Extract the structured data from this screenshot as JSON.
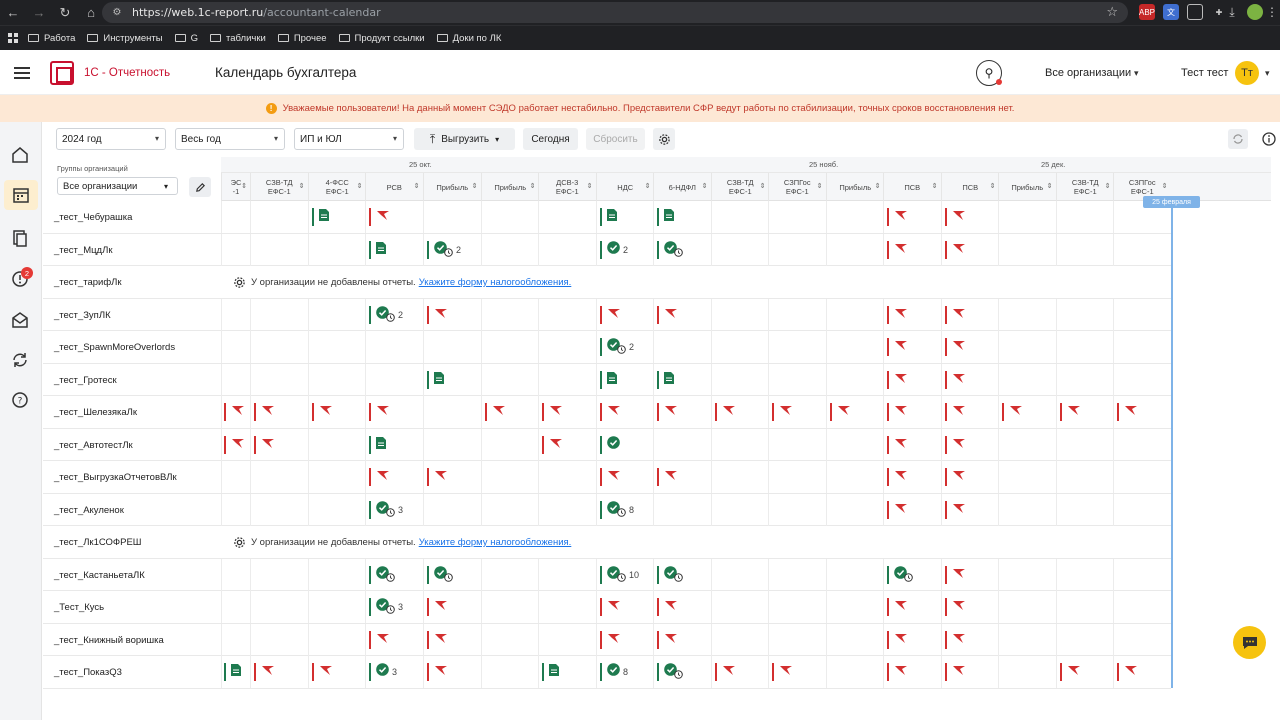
{
  "browser": {
    "url_domain": "https://web.1c-report.ru",
    "url_path": "/accountant-calendar",
    "bookmarks": [
      "Работа",
      "Инструменты",
      "G",
      "таблички",
      "Прочее",
      "Продукт ссылки",
      "Доки по ЛК"
    ]
  },
  "header": {
    "brand": "1С - Отчетность",
    "title": "Календарь бухгалтера",
    "org_select": "Все организации",
    "user_name": "Тест тест",
    "avatar_initials": "Тт",
    "brand_color": "#c8102e",
    "accent_color": "#f6c30f"
  },
  "banner": {
    "text": "Уважаемые пользователи! На данный момент СЭДО работает нестабильно. Представители СФР ведут работы по стабилизации, точных сроков восстановления нет."
  },
  "rail": {
    "items": [
      "home-icon",
      "calendar-icon",
      "documents-icon",
      "alert-icon",
      "mail-icon",
      "sync-icon",
      "help-icon"
    ],
    "alert_badge": "2"
  },
  "toolbar": {
    "year": "2024 год",
    "period": "Весь год",
    "org_type": "ИП и ЮЛ",
    "export_label": "Выгрузить",
    "today_label": "Сегодня",
    "reset_label": "Сбросить"
  },
  "table": {
    "group_label": "Группы организаций",
    "group_select": "Все организации",
    "months": [
      "25 окт.",
      "25 нояб.",
      "25 дек."
    ],
    "columns": [
      {
        "l1": "ЭС",
        "l2": "-1"
      },
      {
        "l1": "СЗВ-ТД",
        "l2": "ЕФС-1"
      },
      {
        "l1": "4-ФСС",
        "l2": "ЕФС-1"
      },
      {
        "l1": "РСВ",
        "l2": ""
      },
      {
        "l1": "Прибыль",
        "l2": ""
      },
      {
        "l1": "Прибыль",
        "l2": ""
      },
      {
        "l1": "ДСВ-3",
        "l2": "ЕФС-1"
      },
      {
        "l1": "НДС",
        "l2": ""
      },
      {
        "l1": "6-НДФЛ",
        "l2": ""
      },
      {
        "l1": "СЗВ-ТД",
        "l2": "ЕФС-1"
      },
      {
        "l1": "СЗПГос",
        "l2": "ЕФС-1"
      },
      {
        "l1": "Прибыль",
        "l2": ""
      },
      {
        "l1": "ПСВ",
        "l2": ""
      },
      {
        "l1": "ПСВ",
        "l2": ""
      },
      {
        "l1": "Прибыль",
        "l2": ""
      },
      {
        "l1": "СЗВ-ТД",
        "l2": "ЕФС-1"
      },
      {
        "l1": "СЗПГос",
        "l2": "ЕФС-1"
      }
    ],
    "today_tag": "25 февраля",
    "no_reports_text": "У организации не добавлены отчеты.",
    "no_reports_link": "Укажите форму налогообложения.",
    "rows": [
      {
        "name": "_тест_Чебурашка",
        "cells": {
          "2": "doc",
          "3": "flag",
          "7": "doc",
          "8": "doc",
          "12": "flag",
          "13": "flag"
        }
      },
      {
        "name": "_тест_МцдЛк",
        "cells": {
          "3": "doc",
          "4": "ok2",
          "7": "ok|2",
          "8": "okc",
          "12": "flag",
          "13": "flag"
        }
      },
      {
        "name": "_тест_тарифЛк",
        "empty": true
      },
      {
        "name": "_тест_ЗупЛК",
        "cells": {
          "3": "okc|2",
          "4": "flag",
          "7": "flag",
          "8": "flag",
          "12": "flag",
          "13": "flag"
        }
      },
      {
        "name": "_тест_SpawnMoreOverlords",
        "cells": {
          "7": "okc|2",
          "12": "flag",
          "13": "flag"
        }
      },
      {
        "name": "_тест_Гротеск",
        "cells": {
          "4": "doc",
          "7": "doc",
          "8": "doc",
          "12": "flag",
          "13": "flag"
        }
      },
      {
        "name": "_тест_ШелезякаЛк",
        "cells": {
          "0": "flag",
          "1": "flag",
          "2": "flag",
          "3": "flag",
          "5": "flag",
          "6": "flag",
          "7": "flag",
          "8": "flag",
          "9": "flag",
          "10": "flag",
          "11": "flag",
          "12": "flag",
          "13": "flag",
          "14": "flag",
          "15": "flag",
          "16": "flag"
        }
      },
      {
        "name": "_тест_АвтотестЛк",
        "cells": {
          "0": "flag",
          "1": "flag",
          "3": "doc",
          "6": "flag",
          "7": "ok",
          "12": "flag",
          "13": "flag"
        }
      },
      {
        "name": "_тест_ВыгрузкаОтчетовВЛк",
        "cells": {
          "3": "flag",
          "4": "flag",
          "7": "flag",
          "8": "flag",
          "12": "flag",
          "13": "flag"
        }
      },
      {
        "name": "_тест_Акуленок",
        "cells": {
          "3": "okc|3",
          "7": "okc|8",
          "12": "flag",
          "13": "flag"
        }
      },
      {
        "name": "_тест_Лк1СОФРЕШ",
        "empty": true
      },
      {
        "name": "_тест_КастаньетаЛК",
        "cells": {
          "3": "okc",
          "4": "okc",
          "7": "okc|10",
          "8": "okc",
          "12": "okc",
          "13": "flag"
        }
      },
      {
        "name": "_Тест_Кусь",
        "cells": {
          "3": "okc|3",
          "4": "flag",
          "7": "flag",
          "8": "flag",
          "12": "flag",
          "13": "flag"
        }
      },
      {
        "name": "_тест_Книжный воришка",
        "cells": {
          "3": "flag",
          "4": "flag",
          "7": "flag",
          "8": "flag",
          "12": "flag",
          "13": "flag"
        }
      },
      {
        "name": "_тест_ПоказQ3",
        "cells": {
          "0": "doc",
          "1": "flag",
          "2": "flag",
          "3": "ok|3",
          "4": "flag",
          "6": "doc",
          "7": "ok|8",
          "8": "okc",
          "9": "flag",
          "10": "flag",
          "12": "flag",
          "13": "flag",
          "15": "flag",
          "16": "flag"
        }
      }
    ]
  },
  "status_colors": {
    "overdue": "#d32f2f",
    "done": "#1e7a4f",
    "today": "#7fb3e8"
  }
}
